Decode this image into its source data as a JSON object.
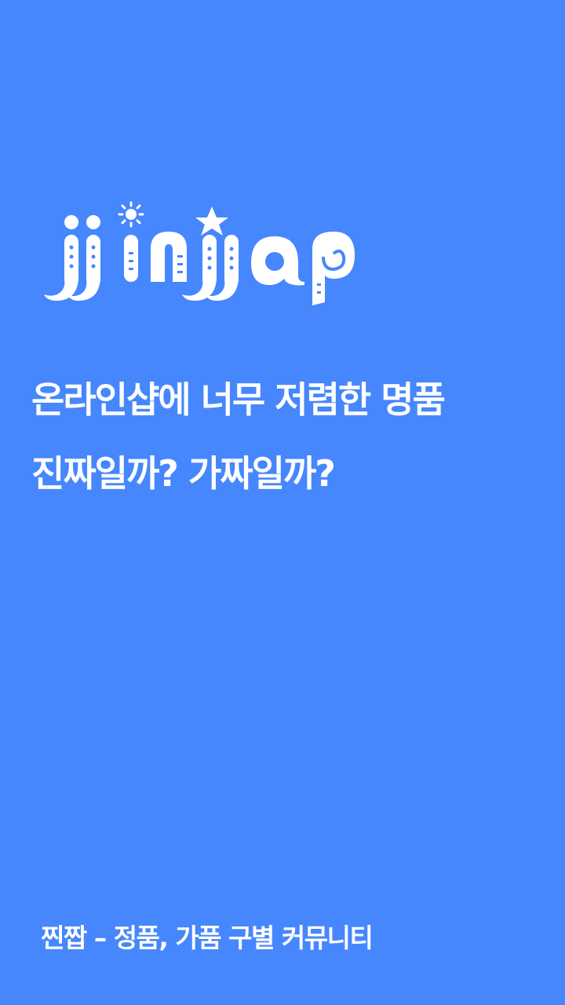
{
  "brand": {
    "logo_text": "jjinjjap",
    "background_color": "#4687fd",
    "text_color": "#ffffff"
  },
  "headline": {
    "line1": "온라인샵에 너무 저렴한 명품",
    "line2": "진짜일까?  가짜일까?"
  },
  "footer": {
    "tagline": "찐짭 – 정품, 가품 구별 커뮤니티"
  },
  "icons": [
    "sun-icon",
    "star-icon"
  ]
}
